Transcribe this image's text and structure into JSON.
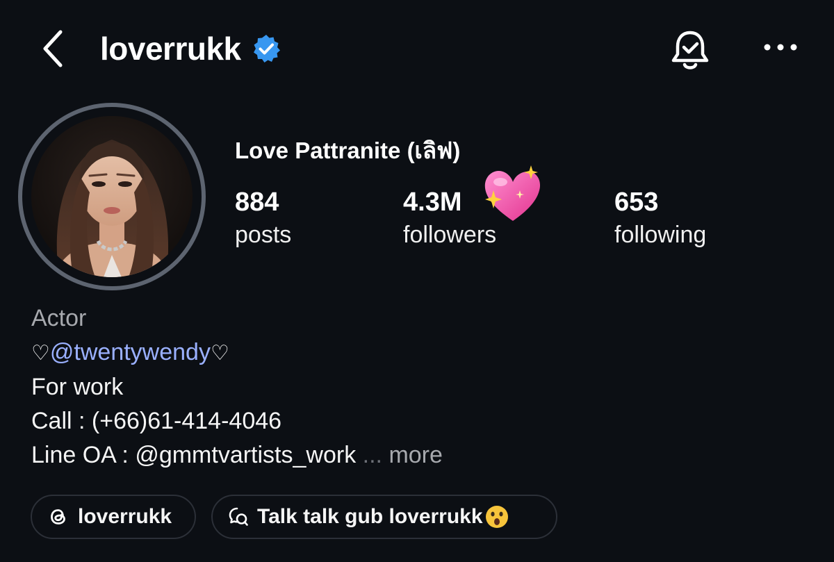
{
  "header": {
    "username": "loverrukk",
    "back_icon": "chevron-left-icon",
    "verified_icon": "verified-badge-icon",
    "bell_icon": "bell-check-icon",
    "more_icon": "more-horizontal-icon",
    "verified_color": "#3897f0"
  },
  "profile": {
    "display_name": "Love Pattranite (เลิฟ)",
    "stats": [
      {
        "value": "884",
        "label": "posts"
      },
      {
        "value": "4.3M",
        "label": "followers"
      },
      {
        "value": "653",
        "label": "following"
      }
    ],
    "decoration_icon": "sparkling-heart-icon"
  },
  "bio": {
    "category": "Actor",
    "mention_prefix": "♡",
    "mention": "@twentywendy",
    "mention_suffix": "♡",
    "line_work": "For work",
    "line_call": "Call : (+66)61-414-4046",
    "line_oa": "Line OA : @gmmtvartists_work",
    "ellipsis": "...",
    "more": "more",
    "mention_color": "#9ab0ff"
  },
  "chips": {
    "threads": {
      "label": "loverrukk",
      "icon": "threads-icon"
    },
    "channel": {
      "label": "Talk talk gub loverrukk",
      "icon": "broadcast-channel-icon",
      "emoji_icon": "astonished-face-icon"
    }
  }
}
